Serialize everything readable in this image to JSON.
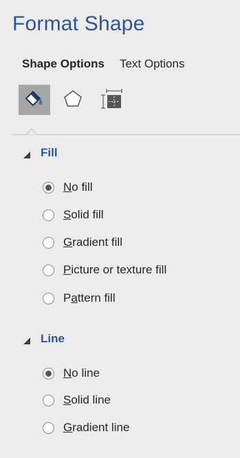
{
  "pane": {
    "title": "Format Shape"
  },
  "tabs": [
    {
      "label": "Shape Options",
      "active": true
    },
    {
      "label": "Text Options",
      "active": false
    }
  ],
  "icons": [
    {
      "name": "fill-line-icon",
      "selected": true
    },
    {
      "name": "effects-icon",
      "selected": false
    },
    {
      "name": "size-properties-icon",
      "selected": false
    }
  ],
  "fill": {
    "header": "Fill",
    "options": [
      {
        "label": "No fill",
        "accesskey": "N",
        "checked": true
      },
      {
        "label": "Solid fill",
        "accesskey": "S",
        "checked": false
      },
      {
        "label": "Gradient fill",
        "accesskey": "G",
        "checked": false
      },
      {
        "label": "Picture or texture fill",
        "accesskey": "P",
        "checked": false
      },
      {
        "label": "Pattern fill",
        "accesskey": "a",
        "checked": false
      }
    ]
  },
  "line": {
    "header": "Line",
    "options": [
      {
        "label": "No line",
        "accesskey": "N",
        "checked": true
      },
      {
        "label": "Solid line",
        "accesskey": "S",
        "checked": false
      },
      {
        "label": "Gradient line",
        "accesskey": "G",
        "checked": false
      }
    ]
  },
  "colors": {
    "accent": "#2f5597",
    "pane_bg": "#ececec",
    "selected_icon_bg": "#a6a6a6"
  }
}
